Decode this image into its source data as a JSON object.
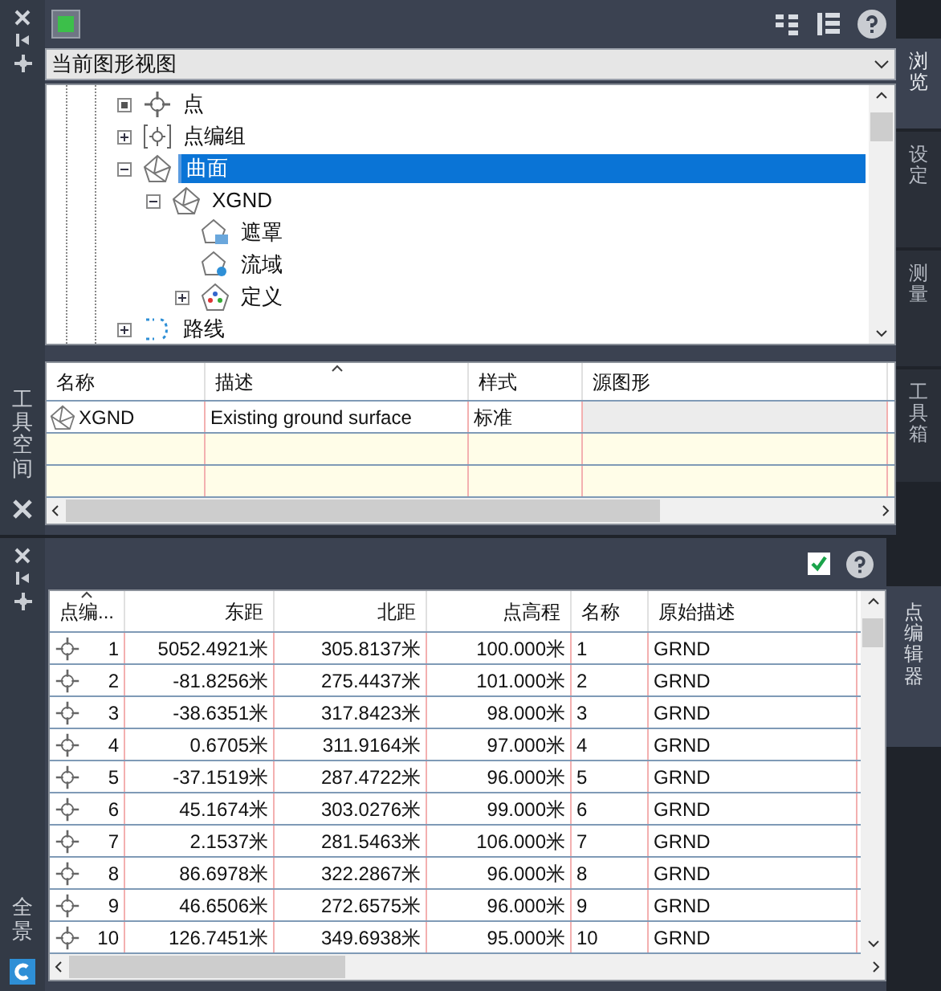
{
  "toolspace": {
    "side_label": "工具空间",
    "view_selector": {
      "value": "当前图形视图"
    },
    "tabs": [
      {
        "label": "浏览",
        "selected": true
      },
      {
        "label": "设定",
        "selected": false
      },
      {
        "label": "测量",
        "selected": false
      },
      {
        "label": "工具箱",
        "selected": false
      }
    ],
    "tree": [
      {
        "label": "点",
        "kind": "point",
        "selected": false
      },
      {
        "label": "点编组",
        "kind": "group",
        "expanded": false,
        "selected": false
      },
      {
        "label": "曲面",
        "kind": "surface",
        "expanded": true,
        "selected": true,
        "children": [
          {
            "label": "XGND",
            "kind": "surface",
            "expanded": true,
            "selected": false,
            "children": [
              {
                "label": "遮罩",
                "kind": "mask",
                "selected": false
              },
              {
                "label": "流域",
                "kind": "watershed",
                "selected": false
              },
              {
                "label": "定义",
                "kind": "definition",
                "expanded": false,
                "selected": false
              }
            ]
          }
        ]
      },
      {
        "label": "路线",
        "kind": "alignment",
        "expanded": false,
        "selected": false
      }
    ],
    "list": {
      "columns": [
        {
          "label": "名称",
          "sorted": false
        },
        {
          "label": "描述",
          "sorted": true
        },
        {
          "label": "样式",
          "sorted": false
        },
        {
          "label": "源图形",
          "sorted": false
        }
      ],
      "rows": [
        {
          "cells": [
            "XGND",
            "Existing ground surface",
            "标准",
            ""
          ]
        }
      ]
    }
  },
  "point_editor": {
    "side_label": "全景",
    "tab": "点编辑器",
    "applied": true,
    "columns": [
      {
        "label": "点编...",
        "sorted": true
      },
      {
        "label": "东距"
      },
      {
        "label": "北距"
      },
      {
        "label": "点高程"
      },
      {
        "label": "名称"
      },
      {
        "label": "原始描述"
      }
    ],
    "rows": [
      [
        "1",
        "5052.4921米",
        "305.8137米",
        "100.000米",
        "1",
        "GRND"
      ],
      [
        "2",
        "-81.8256米",
        "275.4437米",
        "101.000米",
        "2",
        "GRND"
      ],
      [
        "3",
        "-38.6351米",
        "317.8423米",
        "98.000米",
        "3",
        "GRND"
      ],
      [
        "4",
        "0.6705米",
        "311.9164米",
        "97.000米",
        "4",
        "GRND"
      ],
      [
        "5",
        "-37.1519米",
        "287.4722米",
        "96.000米",
        "5",
        "GRND"
      ],
      [
        "6",
        "45.1674米",
        "303.0276米",
        "99.000米",
        "6",
        "GRND"
      ],
      [
        "7",
        "2.1537米",
        "281.5463米",
        "106.000米",
        "7",
        "GRND"
      ],
      [
        "8",
        "86.6978米",
        "322.2867米",
        "96.000米",
        "8",
        "GRND"
      ],
      [
        "9",
        "46.6506米",
        "272.6575米",
        "96.000米",
        "9",
        "GRND"
      ],
      [
        "10",
        "126.7451米",
        "349.6938米",
        "95.000米",
        "10",
        "GRND"
      ]
    ]
  }
}
